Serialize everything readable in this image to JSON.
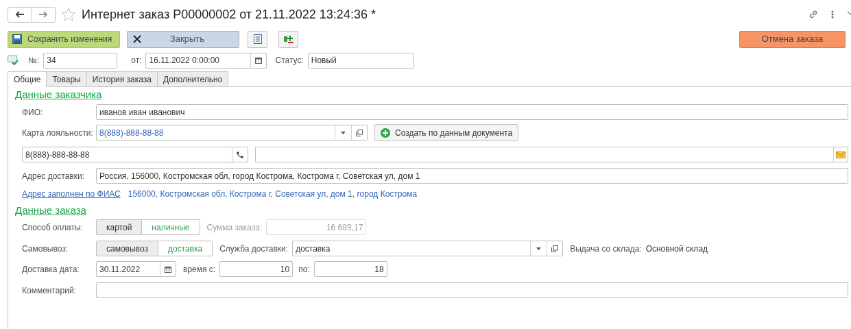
{
  "window": {
    "title": "Интернет заказ P00000002 от 21.11.2022 13:24:36 *",
    "favorite": false
  },
  "toolbar": {
    "save": "Сохранить изменения",
    "close": "Закрыть",
    "cancel_order": "Отмена заказа"
  },
  "header": {
    "number_label": "№:",
    "number": "34",
    "date_label": "от:",
    "date": "16.11.2022  0:00:00",
    "status_label": "Статус:",
    "status": "Новый"
  },
  "tabs": [
    {
      "label": "Общие",
      "selected": true
    },
    {
      "label": "Товары",
      "selected": false
    },
    {
      "label": "История заказа",
      "selected": false
    },
    {
      "label": "Дополнительно",
      "selected": false
    }
  ],
  "customer": {
    "heading": "Данные заказчика",
    "fio_label": "ФИО:",
    "fio": "иванов иван иванович",
    "card_label": "Карта лояльности:",
    "card": "8(888)-888-88-88",
    "create_button": "Создать по данным документа",
    "phone": "8(888)-888-88-88",
    "address_label": "Адрес доставки:",
    "address": "Россия, 156000, Костромская обл, город Кострома, Кострома г, Советская ул, дом 1",
    "fias_link": "Адрес заполнен по ФИАС",
    "fias_address": "156000, Костромская обл, Кострома г, Советская ул, дом 1, город Кострома"
  },
  "order": {
    "heading": "Данные заказа",
    "payment_label": "Способ оплаты:",
    "payment_options": [
      {
        "label": "картой",
        "selected": true
      },
      {
        "label": "наличные",
        "selected": false
      }
    ],
    "sum_label": "Сумма заказа:",
    "sum": "16 689,17",
    "pickup_label": "Самовывоз:",
    "pickup_options": [
      {
        "label": "самовывоз",
        "selected": true
      },
      {
        "label": "доставка",
        "selected": false
      }
    ],
    "service_label": "Служба доставки:",
    "service": "доставка",
    "warehouse_label": "Выдача со склада:",
    "warehouse": "Основной склад",
    "date_label": "Доставка дата:",
    "date": "30.11.2022",
    "time_from_label": "время с:",
    "time_from": "10",
    "time_to_label": "по:",
    "time_to": "18",
    "comment_label": "Комментарий:"
  }
}
